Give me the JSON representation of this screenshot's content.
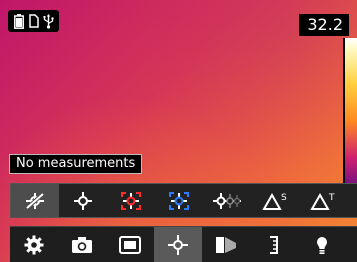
{
  "status": {
    "icons": [
      "battery-icon",
      "sd-card-icon",
      "usb-icon"
    ]
  },
  "temperature": {
    "value": "32.2"
  },
  "measurement": {
    "label": "No measurements"
  },
  "measure_toolbar": {
    "items": [
      {
        "name": "no-measurement-icon",
        "selected": true
      },
      {
        "name": "spot-icon",
        "selected": false
      },
      {
        "name": "box-hot-icon",
        "selected": false
      },
      {
        "name": "box-cold-icon",
        "selected": false
      },
      {
        "name": "three-spots-icon",
        "selected": false
      },
      {
        "name": "delta-s-icon",
        "label": "S",
        "selected": false
      },
      {
        "name": "delta-t-icon",
        "label": "T",
        "selected": false
      }
    ]
  },
  "main_toolbar": {
    "items": [
      {
        "name": "settings-icon",
        "selected": false
      },
      {
        "name": "camera-icon",
        "selected": false
      },
      {
        "name": "image-mode-icon",
        "selected": false
      },
      {
        "name": "measurement-icon",
        "selected": true
      },
      {
        "name": "color-palette-icon",
        "selected": false
      },
      {
        "name": "scale-icon",
        "selected": false
      },
      {
        "name": "lamp-icon",
        "selected": false
      }
    ]
  },
  "colors": {
    "hot": "#ff2a2a",
    "cold": "#2a7cff",
    "accent": "#ffffff"
  }
}
